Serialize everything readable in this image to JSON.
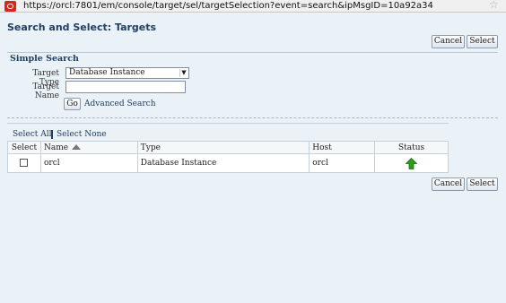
{
  "browser": {
    "url": "https://orcl:7801/em/console/target/sel/targetSelection?event=search&ipMsgID=10a92a34"
  },
  "page": {
    "title": "Search and Select: Targets"
  },
  "actions": {
    "cancel_label": "Cancel",
    "select_label": "Select"
  },
  "search": {
    "section_title": "Simple Search",
    "target_type_label": "Target Type",
    "target_type_value": "Database Instance",
    "target_name_label": "Target Name",
    "target_name_value": "",
    "go_label": "Go",
    "advanced_link": "Advanced Search"
  },
  "results": {
    "select_all": "Select All",
    "select_none": "Select None",
    "columns": {
      "select": "Select",
      "name": "Name",
      "type": "Type",
      "host": "Host",
      "status": "Status"
    },
    "rows": [
      {
        "checked": false,
        "name": "orcl",
        "type": "Database Instance",
        "host": "orcl",
        "status": "up",
        "status_icon": "up-arrow-icon"
      }
    ]
  },
  "colors": {
    "title": "#1f3f63",
    "status_up": "#2e9b1f"
  }
}
